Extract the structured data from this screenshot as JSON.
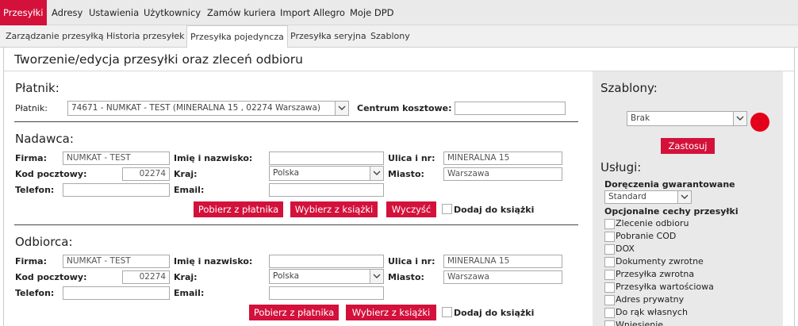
{
  "menu_primary": [
    "Przesyłki",
    "Adresy",
    "Ustawienia",
    "Użytkownicy",
    "Zamów kuriera",
    "Import Allegro",
    "Moje DPD"
  ],
  "menu_secondary": [
    "Zarządzanie przesyłką",
    "Historia przesyłek",
    "Przesyłka pojedyncza",
    "Przesyłka seryjna",
    "Szablony"
  ],
  "page_title": "Tworzenie/edycja przesyłki oraz zleceń odbioru",
  "payer": {
    "section": "Płatnik:",
    "label": "Płatnik:",
    "value": "74671 - NUMKAT - TEST (MINERALNA 15 , 02274 Warszawa)",
    "cost_center_label": "Centrum kosztowe:",
    "cost_center_value": ""
  },
  "sender": {
    "section": "Nadawca:",
    "company_label": "Firma:",
    "company": "NUMKAT - TEST",
    "name_label": "Imię i nazwisko:",
    "name": "",
    "street_label": "Ulica i nr:",
    "street": "MINERALNA 15",
    "zip_label": "Kod pocztowy:",
    "zip": "02274",
    "country_label": "Kraj:",
    "country": "Polska",
    "city_label": "Miasto:",
    "city": "Warszawa",
    "phone_label": "Telefon:",
    "phone": "",
    "email_label": "Email:",
    "email": "",
    "btn_from_payer": "Pobierz z płatnika",
    "btn_from_book": "Wybierz z książki",
    "btn_clear": "Wyczyść",
    "add_to_book": "Dodaj do książki"
  },
  "recipient": {
    "section": "Odbiorca:",
    "company_label": "Firma:",
    "company": "NUMKAT - TEST",
    "name_label": "Imię i nazwisko:",
    "name": "",
    "street_label": "Ulica i nr:",
    "street": "MINERALNA 15",
    "zip_label": "Kod pocztowy:",
    "zip": "02274",
    "country_label": "Kraj:",
    "country": "Polska",
    "city_label": "Miasto:",
    "city": "Warszawa",
    "phone_label": "Telefon:",
    "phone": "",
    "email_label": "Email:",
    "email": "",
    "btn_from_payer": "Pobierz z płatnika",
    "btn_from_book": "Wybierz z książki",
    "add_to_book": "Dodaj do książki"
  },
  "side": {
    "templates_title": "Szablony:",
    "template_value": "Brak",
    "apply": "Zastosuj",
    "services_title": "Usługi:",
    "guaranteed_label": "Doręczenia gwarantowane",
    "guaranteed_value": "Standard",
    "optional_label": "Opcjonalne cechy przesyłki",
    "options": [
      "Zlecenie odbioru",
      "Pobranie COD",
      "DOX",
      "Dokumenty zwrotne",
      "Przesyłka zwrotna",
      "Przesyłka wartościowa",
      "Adres prywatny",
      "Do rąk własnych",
      "Wniesienie"
    ]
  },
  "colors": {
    "accent": "#d3113b",
    "dot": "#e3001b"
  }
}
